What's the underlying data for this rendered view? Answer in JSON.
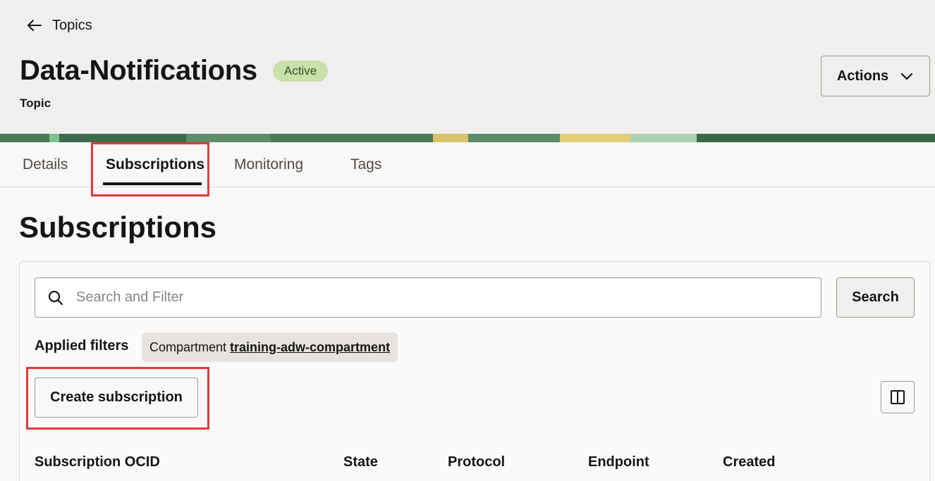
{
  "header": {
    "back_label": "Topics",
    "title": "Data-Notifications",
    "status": "Active",
    "subtitle": "Topic",
    "actions_label": "Actions"
  },
  "tabs": [
    {
      "label": "Details",
      "active": false
    },
    {
      "label": "Subscriptions",
      "active": true
    },
    {
      "label": "Monitoring",
      "active": false
    },
    {
      "label": "Tags",
      "active": false
    }
  ],
  "section": {
    "heading": "Subscriptions"
  },
  "search": {
    "placeholder": "Search and Filter",
    "value": "",
    "button_label": "Search"
  },
  "filters": {
    "label": "Applied filters",
    "chip_key": "Compartment",
    "chip_value": "training-adw-compartment"
  },
  "toolbar": {
    "create_label": "Create subscription"
  },
  "table": {
    "columns": [
      "Subscription OCID",
      "State",
      "Protocol",
      "Endpoint",
      "Created"
    ]
  },
  "icons": {
    "back": "arrow-left-icon",
    "actions": "chevron-down-icon",
    "search": "search-icon",
    "columns": "columns-icon"
  },
  "colors": {
    "header_bg": "#f1efed",
    "status_badge_bg": "#c9e0a8",
    "highlight": "#e03a3e",
    "active_tab": "#161513"
  }
}
